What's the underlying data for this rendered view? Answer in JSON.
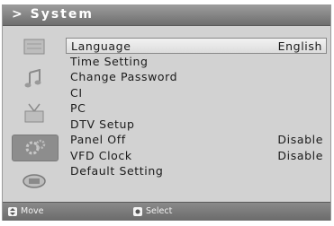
{
  "header": {
    "title": "> System"
  },
  "sidebar": {
    "items": [
      {
        "icon": "picture-icon"
      },
      {
        "icon": "sound-icon"
      },
      {
        "icon": "channel-antenna-icon"
      },
      {
        "icon": "setup-icon"
      },
      {
        "icon": "input-source-icon"
      }
    ]
  },
  "menu": {
    "items": [
      {
        "label": "Language",
        "value": "English"
      },
      {
        "label": "Time Setting",
        "value": ""
      },
      {
        "label": "Change Password",
        "value": ""
      },
      {
        "label": "CI",
        "value": ""
      },
      {
        "label": "PC",
        "value": ""
      },
      {
        "label": "DTV Setup",
        "value": ""
      },
      {
        "label": "Panel Off",
        "value": "Disable"
      },
      {
        "label": "VFD Clock",
        "value": "Disable"
      },
      {
        "label": "Default Setting",
        "value": ""
      }
    ]
  },
  "footer": {
    "move_label": "Move",
    "select_label": "Select"
  }
}
